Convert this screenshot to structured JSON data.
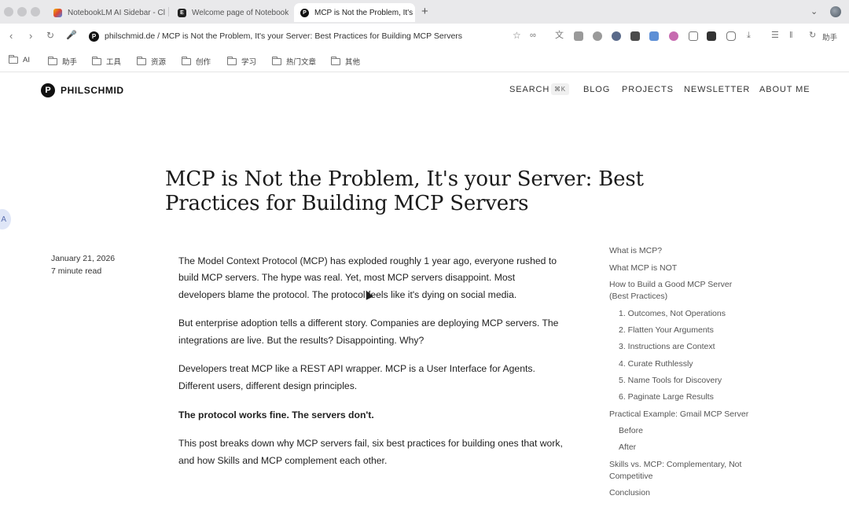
{
  "browser": {
    "tabs": [
      {
        "title": "NotebookLM AI Sidebar - Cl",
        "active": false
      },
      {
        "title": "Welcome page of Notebook",
        "active": false
      },
      {
        "title": "MCP is Not the Problem, It's",
        "active": true
      }
    ],
    "new_tab": "+",
    "url": "philschmid.de / MCP is Not the Problem, It's your Server: Best Practices for Building MCP Servers",
    "extension_label": "助手",
    "bookmarks": [
      "AI",
      "助手",
      "工具",
      "资源",
      "创作",
      "学习",
      "热门文章",
      "其他"
    ]
  },
  "site": {
    "logo_letter": "P",
    "brand": "PHILSCHMID",
    "nav": {
      "search": "SEARCH",
      "search_shortcut": "⌘K",
      "blog": "BLOG",
      "projects": "PROJECTS",
      "newsletter": "NEWSLETTER",
      "about": "ABOUT ME"
    }
  },
  "post": {
    "title_line1": "MCP is Not the Problem, It's your Server: Best",
    "title_line2": "Practices for Building MCP Servers",
    "date": "January 21, 2026",
    "read_time": "7 minute read",
    "paragraphs": [
      "The Model Context Protocol (MCP) has exploded roughly 1 year ago, everyone rushed to build MCP servers. The hype was real. Yet, most MCP servers disappoint. Most developers blame the protocol. The protocol feels like it's dying on social media.",
      "But enterprise adoption tells a different story. Companies are deploying MCP servers. The integrations are live. But the results? Disappointing. Why?",
      "Developers treat MCP like a REST API wrapper. MCP is a User Interface for Agents. Different users, different design principles.",
      "The protocol works fine. The servers don't.",
      "This post breaks down why MCP servers fail, six best practices for building ones that work, and how Skills and MCP complement each other."
    ]
  },
  "toc": [
    "What is MCP?",
    "What MCP is NOT",
    "How to Build a Good MCP Server",
    "(Best Practices)",
    "1. Outcomes, Not Operations",
    "2. Flatten Your Arguments",
    "3. Instructions are Context",
    "4. Curate Ruthlessly",
    "5. Name Tools for Discovery",
    "6. Paginate Large Results",
    "Practical Example: Gmail MCP Server",
    "Before",
    "After",
    "Skills vs. MCP: Complementary, Not",
    "Competitive",
    "Conclusion"
  ],
  "colors": {
    "tabbar": "#e9e9eb",
    "text": "#1f1f1f",
    "toc_text": "#555555"
  }
}
